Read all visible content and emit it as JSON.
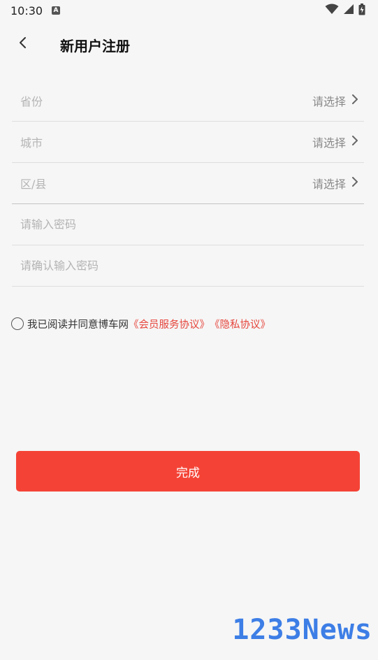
{
  "status_bar": {
    "time": "10:30",
    "notification_icon": "a-icon",
    "icons": [
      "wifi-icon",
      "signal-icon",
      "battery-icon"
    ]
  },
  "header": {
    "back_icon": "chevron-left-icon",
    "title": "新用户注册"
  },
  "form": {
    "select_rows": [
      {
        "label": "省份",
        "action": "请选择",
        "icon": "chevron-right-icon"
      },
      {
        "label": "城市",
        "action": "请选择",
        "icon": "chevron-right-icon"
      },
      {
        "label": "区/县",
        "action": "请选择",
        "icon": "chevron-right-icon"
      }
    ],
    "password_placeholder": "请输入密码",
    "confirm_placeholder": "请确认输入密码"
  },
  "agreement": {
    "text": "我已阅读并同意博车网",
    "member_link": "《会员服务协议》",
    "privacy_link": "《隐私协议》",
    "checked": false
  },
  "submit": {
    "label": "完成"
  },
  "watermark": {
    "text": "1233News"
  },
  "colors": {
    "accent": "#f44336",
    "link": "#e6453c",
    "background": "#f6f6f6",
    "watermark": "#3d7ee6"
  }
}
